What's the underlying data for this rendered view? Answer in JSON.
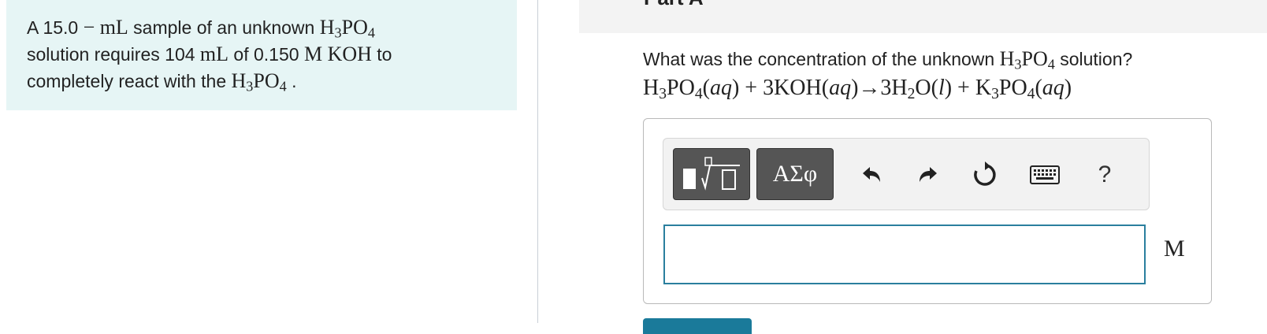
{
  "problem": {
    "text_1": "A 15.0 ",
    "minus": "−",
    "unit_ml": "mL",
    "text_2": " sample of an unknown ",
    "h": "H",
    "sub3": "3",
    "po": "PO",
    "sub4": "4",
    "line2_a": "solution requires 104 ",
    "unit_ml_2": "mL",
    "line2_b": " of 0.150 ",
    "m_koh": "M KOH",
    "line2_c": " to",
    "line3_a": "completely react with the ",
    "h_b": "H",
    "sub3_b": "3",
    "po_b": "PO",
    "sub4_b": "4",
    "period": " ."
  },
  "part": {
    "title": "Part A",
    "chevron": "›"
  },
  "question": {
    "text_a": "What was the concentration of the unknown ",
    "h": "H",
    "sub3": "3",
    "po": "PO",
    "sub4": "4",
    "text_b": " solution?"
  },
  "equation": {
    "t1": "H",
    "s1": "3",
    "t2": "PO",
    "s2": "4",
    "t3": "(",
    "aq1": "aq",
    "t4": ") + 3KOH(",
    "aq2": "aq",
    "t5": ")→3H",
    "s3": "2",
    "t6": "O(",
    "l": "l",
    "t7": ") + K",
    "s4": "3",
    "t8": "PO",
    "s5": "4",
    "t9": "(",
    "aq3": "aq",
    "t10": ")"
  },
  "toolbar": {
    "greek_label": "ΑΣφ",
    "help_label": "?",
    "icons": [
      "templates-icon",
      "greek-letters-icon",
      "undo-icon",
      "redo-icon",
      "reset-icon",
      "keyboard-icon",
      "help-icon"
    ]
  },
  "answer": {
    "value": "",
    "unit": "M"
  },
  "colors": {
    "problem_bg": "#e6f5f5",
    "input_border": "#2a7f9e",
    "dark_button": "#555555",
    "submit": "#1a7a9a"
  }
}
